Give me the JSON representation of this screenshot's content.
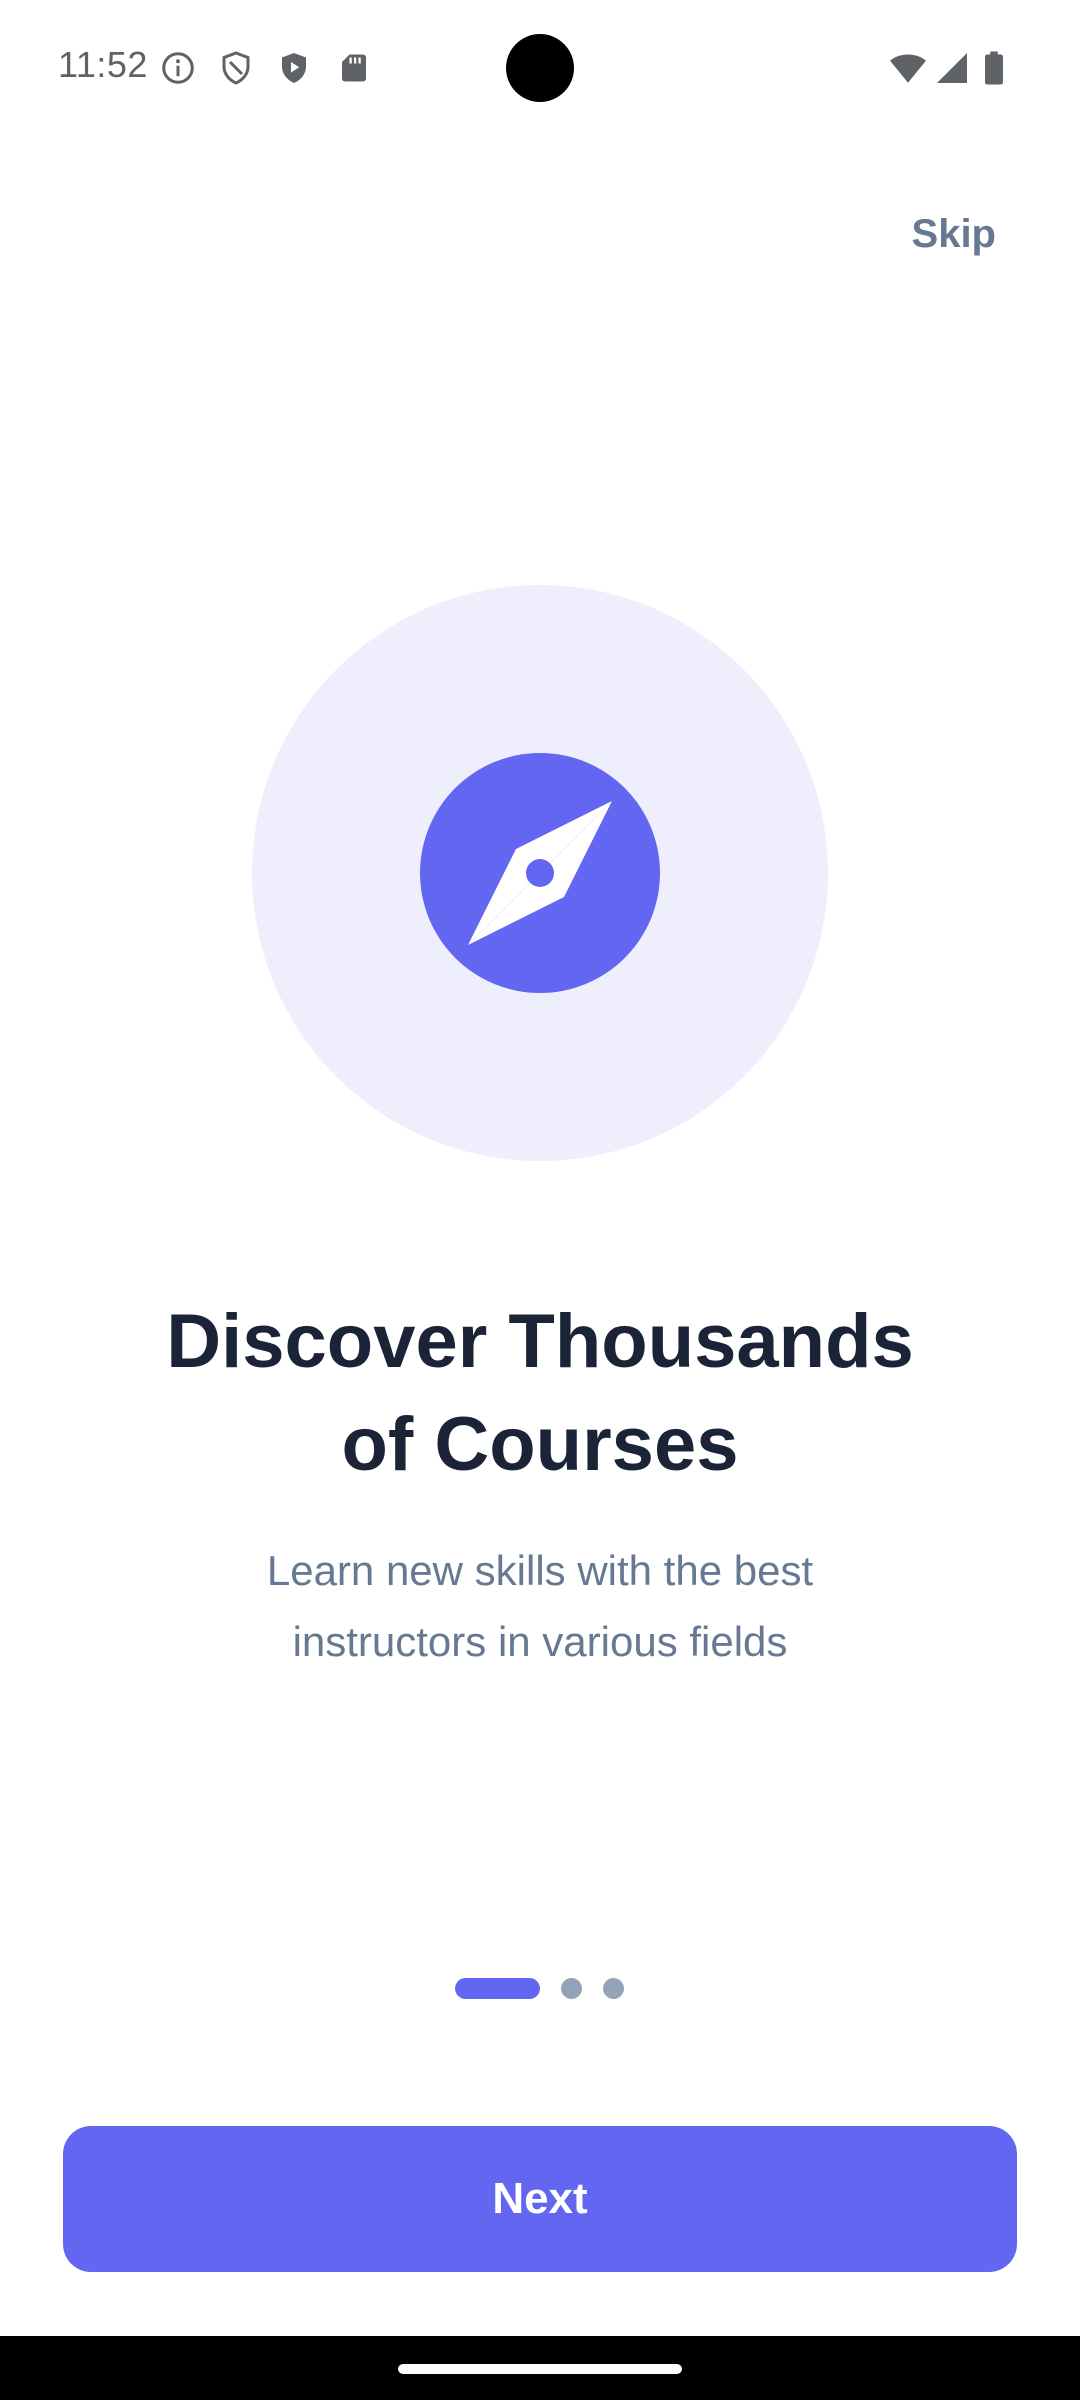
{
  "status_bar": {
    "time": "11:52",
    "icons_left": [
      "info-icon",
      "shield-outline-icon",
      "shield-play-icon",
      "sd-card-icon"
    ],
    "icons_right": [
      "wifi-icon",
      "signal-icon",
      "battery-icon"
    ]
  },
  "header": {
    "skip_label": "Skip"
  },
  "illustration": {
    "icon": "compass-icon",
    "accent_color": "#6366f1",
    "background_color": "#eeeefc"
  },
  "content": {
    "title": "Discover Thousands of Courses",
    "title_line1": "Discover Thousands",
    "title_line2": "of Courses",
    "subtitle_line1": "Learn new skills with the best",
    "subtitle_line2": "instructors in various fields"
  },
  "pager": {
    "current_page": 1,
    "total_pages": 3
  },
  "footer": {
    "next_label": "Next"
  },
  "colors": {
    "primary": "#6366f1",
    "title": "#1b2437",
    "muted": "#667892",
    "dot_inactive": "#94a3b8"
  }
}
